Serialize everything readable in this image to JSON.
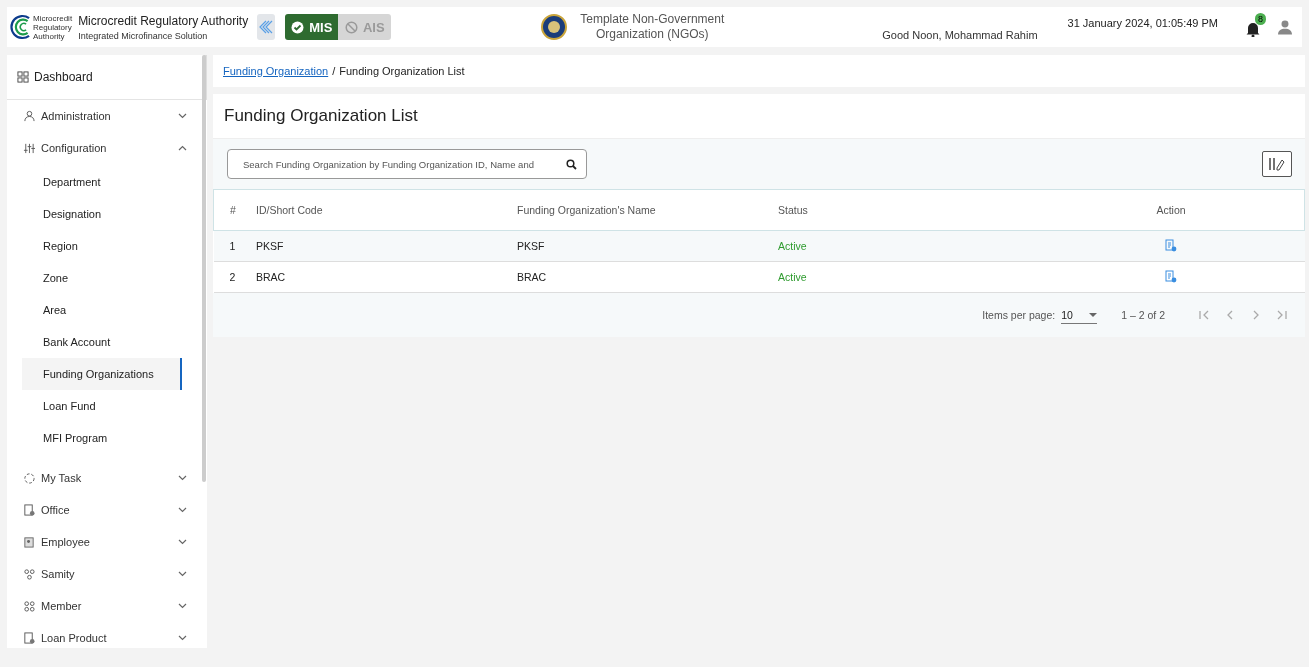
{
  "header": {
    "logo_text": [
      "Microcredit",
      "Regulatory",
      "Authority"
    ],
    "app_title": "Microcredit Regulatory Authority",
    "app_subtitle": "Integrated Microfinance Solution",
    "modules": [
      {
        "label": "MIS",
        "selected": true
      },
      {
        "label": "AIS",
        "selected": false
      }
    ],
    "organization": "Template Non-Government Organization (NGOs)",
    "greeting": "Good Noon, Mohammad Rahim",
    "datetime": "31 January 2024, 01:05:49 PM",
    "notification_count": "8"
  },
  "sidebar": {
    "items": [
      {
        "kind": "link",
        "label": "Dashboard"
      },
      {
        "kind": "group",
        "label": "Administration",
        "expanded": false
      },
      {
        "kind": "group",
        "label": "Configuration",
        "expanded": true,
        "children": [
          {
            "label": "Department",
            "selected": false
          },
          {
            "label": "Designation",
            "selected": false
          },
          {
            "label": "Region",
            "selected": false
          },
          {
            "label": "Zone",
            "selected": false
          },
          {
            "label": "Area",
            "selected": false
          },
          {
            "label": "Bank Account",
            "selected": false
          },
          {
            "label": "Funding Organizations",
            "selected": true
          },
          {
            "label": "Loan Fund",
            "selected": false
          },
          {
            "label": "MFI Program",
            "selected": false
          }
        ]
      },
      {
        "kind": "group",
        "label": "My Task",
        "expanded": false
      },
      {
        "kind": "group",
        "label": "Office",
        "expanded": false
      },
      {
        "kind": "group",
        "label": "Employee",
        "expanded": false
      },
      {
        "kind": "group",
        "label": "Samity",
        "expanded": false
      },
      {
        "kind": "group",
        "label": "Member",
        "expanded": false
      },
      {
        "kind": "group",
        "label": "Loan Product",
        "expanded": false
      }
    ]
  },
  "breadcrumb": [
    {
      "label": "Funding Organization",
      "kind": "link"
    },
    {
      "label": "/",
      "kind": "separator"
    },
    {
      "label": "Funding Organization List",
      "kind": "current"
    }
  ],
  "page_title": "Funding Organization List",
  "search": {
    "placeholder": "Search Funding Organization by Funding Organization ID, Name and"
  },
  "table": {
    "columns": [
      "#",
      "ID/Short Code",
      "Funding Organization's Name",
      "Status",
      "Action"
    ],
    "rows": [
      {
        "index": "1",
        "code": "PKSF",
        "name": "PKSF",
        "status": "Active"
      },
      {
        "index": "2",
        "code": "BRAC",
        "name": "BRAC",
        "status": "Active"
      }
    ]
  },
  "paginator": {
    "label": "Items per page:",
    "page_size": "10",
    "range": "1 – 2 of 2",
    "first_disabled": true,
    "previous_disabled": true,
    "next_disabled": true,
    "last_disabled": true
  }
}
